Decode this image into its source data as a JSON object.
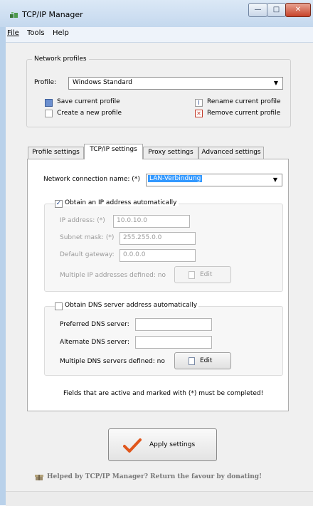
{
  "window": {
    "title": "TCP/IP Manager",
    "min_glyph": "—",
    "max_glyph": "□",
    "close_glyph": "✕"
  },
  "menu": {
    "items": [
      {
        "label": "File"
      },
      {
        "label": "Tools"
      },
      {
        "label": "Help"
      }
    ]
  },
  "profiles": {
    "group_label": "Network profiles",
    "profile_label": "Profile:",
    "profile_value": "Windows Standard",
    "actions": {
      "save": "Save current profile",
      "create": "Create a new profile",
      "rename": "Rename current profile",
      "remove": "Remove current profile"
    }
  },
  "tabs": [
    {
      "label": "Profile settings",
      "active": false
    },
    {
      "label": "TCP/IP settings",
      "active": true
    },
    {
      "label": "Proxy settings",
      "active": false
    },
    {
      "label": "Advanced settings",
      "active": false
    }
  ],
  "tcpip": {
    "connection_label": "Network connection name: (*)",
    "connection_value": "LAN-Verbindung",
    "ip_group": {
      "checkbox_label": "Obtain an IP address automatically",
      "checked": true,
      "ip_label": "IP address: (*)",
      "ip_value": "10.0.10.0",
      "subnet_label": "Subnet mask: (*)",
      "subnet_value": "255.255.0.0",
      "gateway_label": "Default gateway:",
      "gateway_value": "0.0.0.0",
      "multi_label": "Multiple IP addresses defined: no",
      "edit_label": "Edit"
    },
    "dns_group": {
      "checkbox_label": "Obtain DNS server address automatically",
      "checked": false,
      "preferred_label": "Preferred DNS server:",
      "preferred_value": "",
      "alternate_label": "Alternate DNS server:",
      "alternate_value": "",
      "multi_label": "Multiple DNS servers defined: no",
      "edit_label": "Edit"
    },
    "note": "Fields that are active and marked with (*) must be completed!"
  },
  "apply_label": "Apply settings",
  "donate_text": "Helped by TCP/IP Manager? Return the favour by donating!",
  "colors": {
    "title_bg": "#c4d8ee",
    "selection": "#3399ff",
    "checkmark": "#e0561c"
  }
}
